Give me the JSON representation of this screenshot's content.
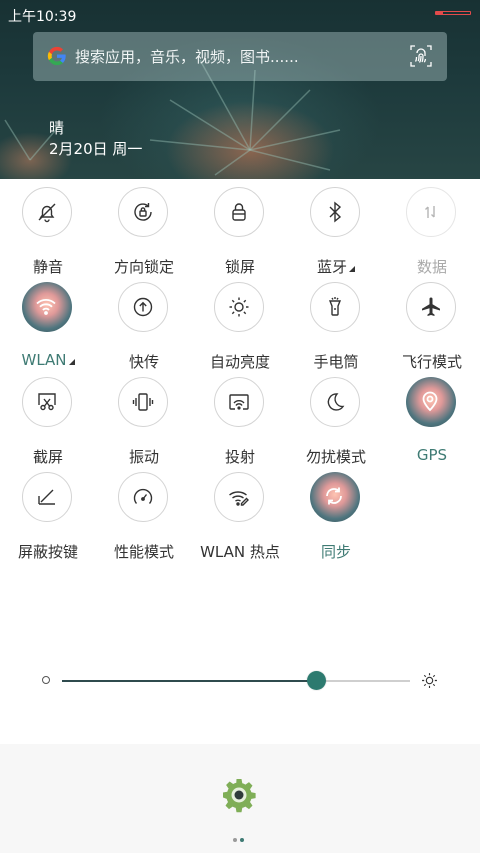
{
  "status": {
    "time": "上午10:39",
    "battery_level_percent": 20
  },
  "search": {
    "placeholder": "搜索应用，音乐，视频，图书......",
    "icon_left": "google-g-icon",
    "icon_right": "fingerprint-icon"
  },
  "weather": {
    "condition": "晴",
    "date": "2月20日 周一"
  },
  "tiles": [
    {
      "label": "静音",
      "icon": "bell-off-icon",
      "on": false
    },
    {
      "label": "方向锁定",
      "icon": "rotation-lock-icon",
      "on": false
    },
    {
      "label": "锁屏",
      "icon": "lock-icon",
      "on": false
    },
    {
      "label": "蓝牙",
      "icon": "bluetooth-icon",
      "on": false,
      "has_menu": true
    },
    {
      "label": "数据",
      "icon": "mobile-data-icon",
      "on": false,
      "dim": true
    },
    {
      "label": "WLAN",
      "icon": "wifi-icon",
      "on": true,
      "has_menu": true
    },
    {
      "label": "快传",
      "icon": "quick-share-icon",
      "on": false
    },
    {
      "label": "自动亮度",
      "icon": "auto-brightness-icon",
      "on": false
    },
    {
      "label": "手电筒",
      "icon": "flashlight-icon",
      "on": false
    },
    {
      "label": "飞行模式",
      "icon": "airplane-icon",
      "on": false
    },
    {
      "label": "截屏",
      "icon": "screenshot-icon",
      "on": false
    },
    {
      "label": "振动",
      "icon": "vibrate-icon",
      "on": false
    },
    {
      "label": "投射",
      "icon": "cast-icon",
      "on": false
    },
    {
      "label": "勿扰模式",
      "icon": "moon-icon",
      "on": false
    },
    {
      "label": "GPS",
      "icon": "location-icon",
      "on": true
    },
    {
      "label": "屏蔽按键",
      "icon": "block-keys-icon",
      "on": false
    },
    {
      "label": "性能模式",
      "icon": "speedometer-icon",
      "on": false
    },
    {
      "label": "WLAN 热点",
      "icon": "hotspot-icon",
      "on": false
    },
    {
      "label": "同步",
      "icon": "sync-icon",
      "on": true
    }
  ],
  "brightness": {
    "level": 0.73
  },
  "bottom": {
    "settings_icon": "gear-icon",
    "page_indicator": {
      "pages": 2,
      "current": 2
    }
  },
  "colors": {
    "accent": "#3f7b74",
    "battery": "#e24b4b",
    "search_bg": "#b4cdcd"
  }
}
